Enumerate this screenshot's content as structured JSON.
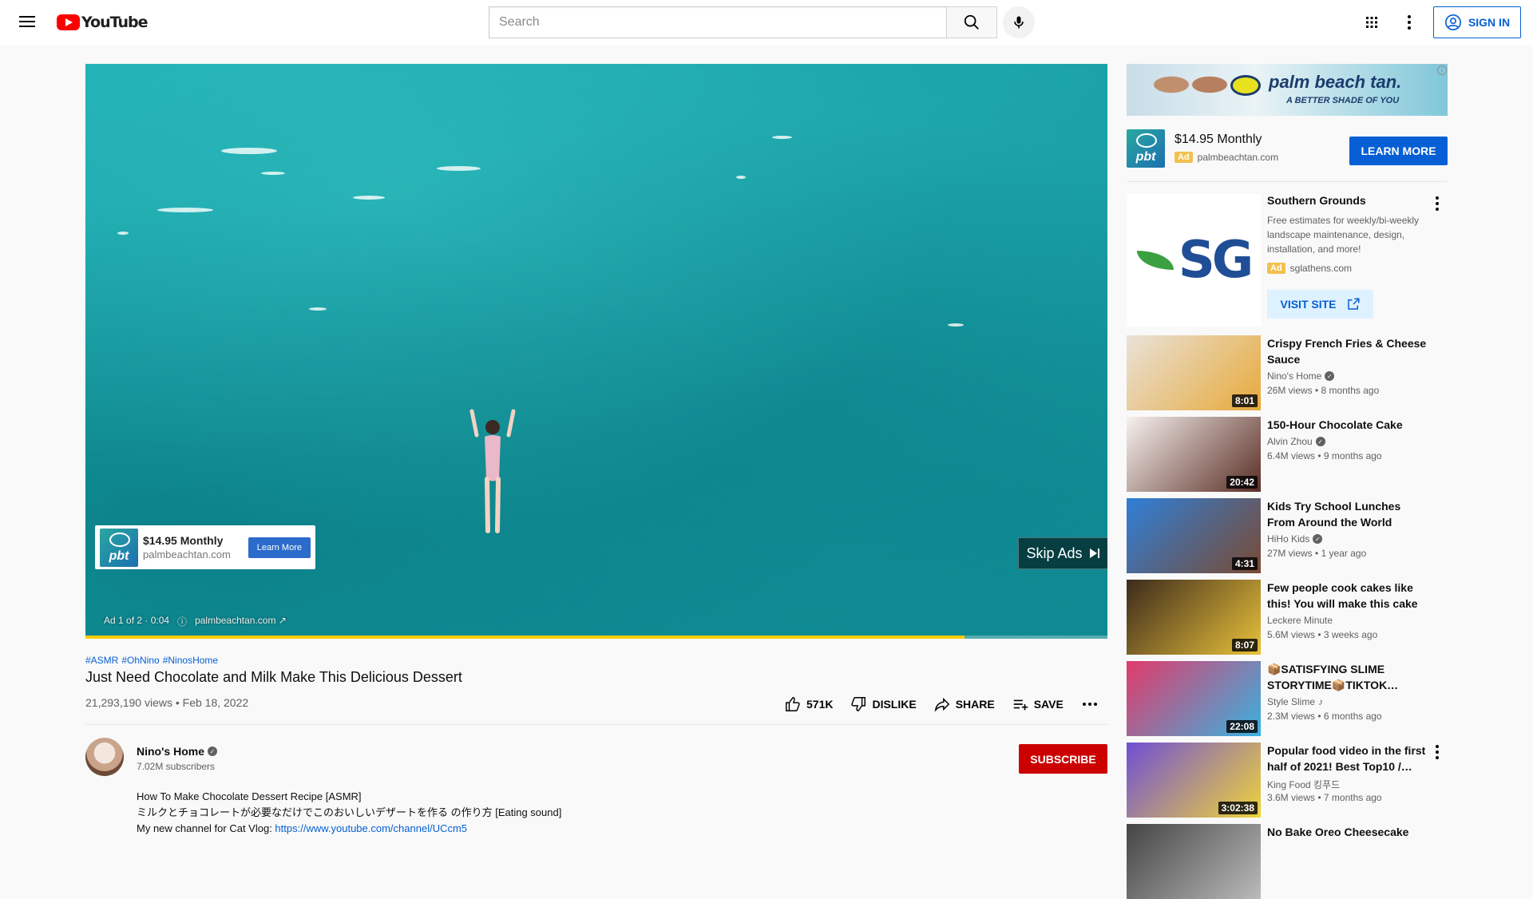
{
  "header": {
    "logo_text": "YouTube",
    "search_placeholder": "Search",
    "sign_in": "SIGN IN"
  },
  "player": {
    "progress": 0.86,
    "ad_overlay": {
      "price": "$14.95 Monthly",
      "site": "palmbeachtan.com",
      "cta": "Learn More",
      "logo": "pbt"
    },
    "skip_label": "Skip Ads",
    "ad_info": {
      "count": "Ad 1 of 2 · 0:04",
      "site": "palmbeachtan.com"
    }
  },
  "video": {
    "hashtags": [
      "#ASMR",
      "#OhNino",
      "#NinosHome"
    ],
    "title": "Just Need Chocolate and Milk Make This Delicious Dessert",
    "views": "21,293,190 views • Feb 18, 2022",
    "actions": {
      "likes": "571K",
      "dislike": "DISLIKE",
      "share": "SHARE",
      "save": "SAVE"
    },
    "channel": {
      "name": "Nino's Home",
      "subscribers": "7.02M subscribers",
      "subscribe": "SUBSCRIBE"
    },
    "description": [
      "How To Make Chocolate Dessert  Recipe [ASMR]",
      "ミルクとチョコレートが必要なだけでこのおいしいデザートを作る の作り方 [Eating sound]"
    ],
    "description_link_prefix": "My new channel for Cat Vlog: ",
    "description_link": "https://www.youtube.com/channel/UCcm5"
  },
  "sidebar": {
    "banner": {
      "brand": "palm beach tan.",
      "tagline": "A BETTER SHADE OF YOU"
    },
    "ad_row": {
      "logo": "pbt",
      "price": "$14.95 Monthly",
      "badge": "Ad",
      "site": "palmbeachtan.com",
      "cta": "LEARN MORE"
    },
    "sg_ad": {
      "logo_text": "SG",
      "title": "Southern Grounds",
      "blurb": "Free estimates for weekly/bi-weekly landscape maintenance, design, installation, and more!",
      "badge": "Ad",
      "site": "sglathens.com",
      "cta": "VISIT SITE"
    },
    "recommendations": [
      {
        "title": "Crispy French Fries & Cheese Sauce",
        "channel": "Nino's Home",
        "verified": true,
        "meta": "26M views • 8 months ago",
        "duration": "8:01",
        "thumb": [
          "#e9e2d8",
          "#e7a93a"
        ]
      },
      {
        "title": "150-Hour Chocolate Cake",
        "channel": "Alvin Zhou",
        "verified": true,
        "meta": "6.4M views • 9 months ago",
        "duration": "20:42",
        "thumb": [
          "#f6f1ee",
          "#5a2e25"
        ]
      },
      {
        "title": "Kids Try School Lunches From Around the World",
        "channel": "HiHo Kids",
        "verified": true,
        "meta": "27M views • 1 year ago",
        "duration": "4:31",
        "thumb": [
          "#2f7fd8",
          "#7a4a33"
        ]
      },
      {
        "title": "Few people cook cakes like this! You will make this cake every…",
        "channel": "Leckere Minute",
        "verified": false,
        "meta": "5.6M views • 3 weeks ago",
        "duration": "8:07",
        "thumb": [
          "#3c2a1c",
          "#e9c23a"
        ]
      },
      {
        "title": "📦SATISFYING SLIME STORYTIME📦TIKTOK…",
        "channel": "Style Slime",
        "verified": false,
        "music": true,
        "meta": "2.3M views • 6 months ago",
        "duration": "22:08",
        "thumb": [
          "#e23a6a",
          "#39b2e0"
        ]
      },
      {
        "title": "Popular food video in the first half of 2021! Best Top10 /…",
        "channel": "King Food 킹푸드",
        "verified": false,
        "meta": "3.6M views • 7 months ago",
        "duration": "3:02:38",
        "thumb": [
          "#6f4fd4",
          "#f0d43a"
        ]
      },
      {
        "title": "No Bake Oreo Cheesecake",
        "channel": "",
        "verified": false,
        "meta": "",
        "duration": "",
        "thumb": [
          "#444444",
          "#bbbbbb"
        ]
      }
    ]
  }
}
